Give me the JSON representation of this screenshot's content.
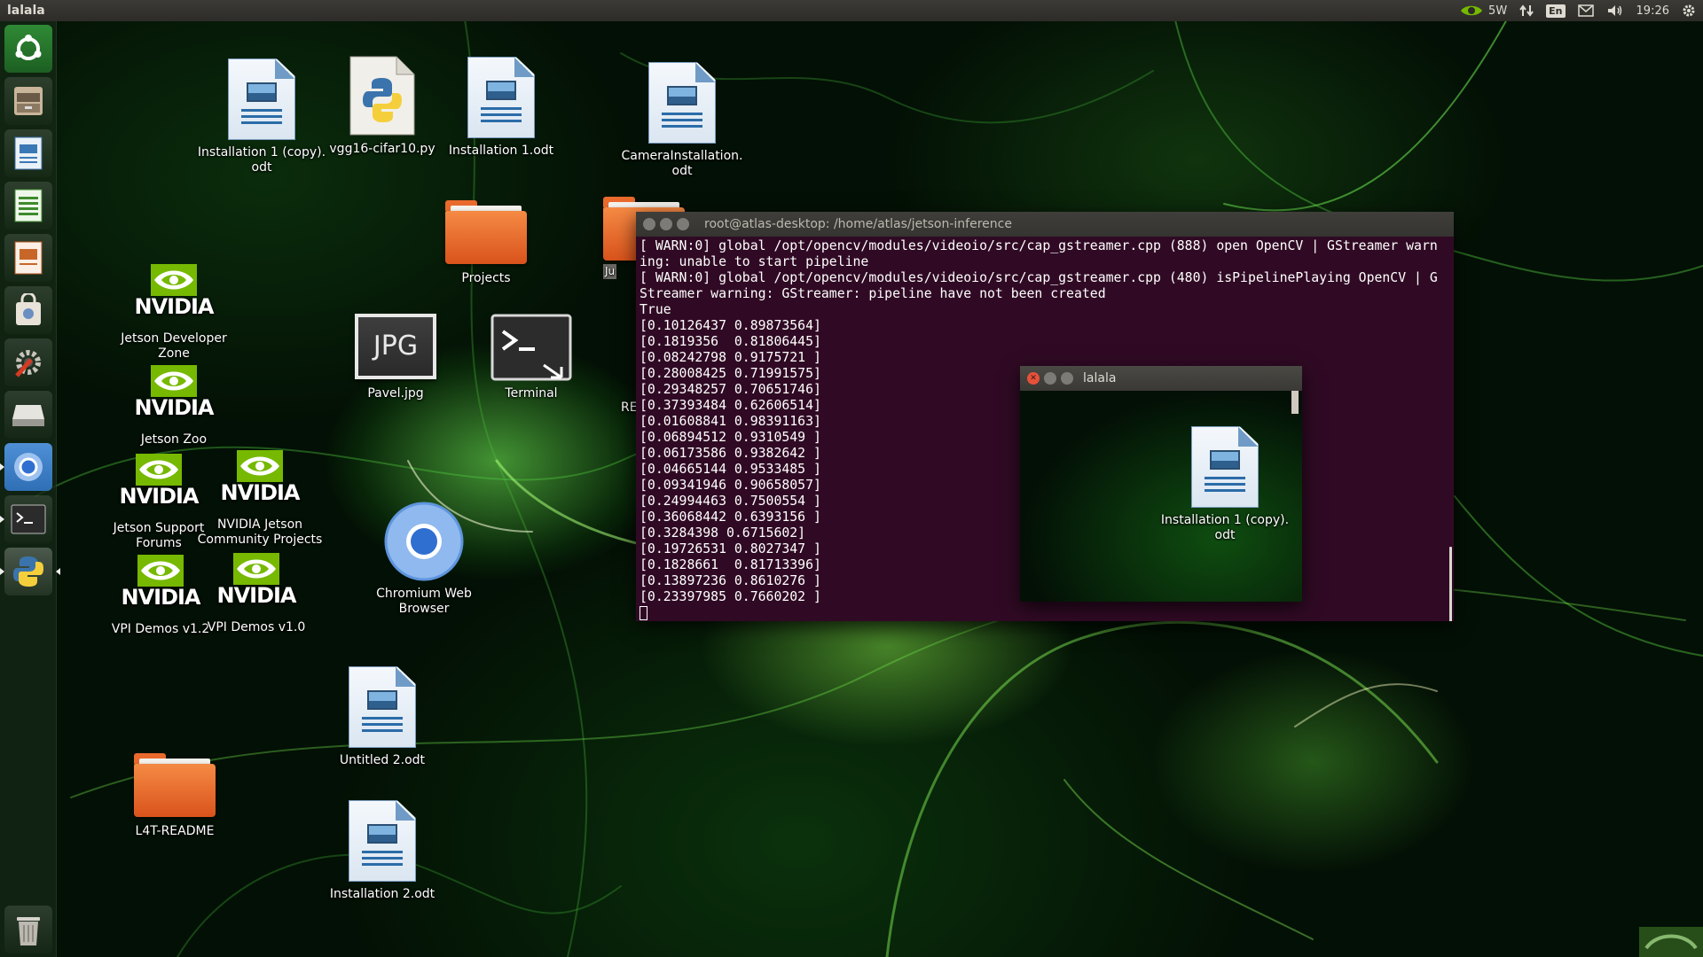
{
  "top_panel": {
    "title": "lalala",
    "tray": {
      "gpu_label": "5W",
      "keyboard_layout": "En",
      "clock": "19:26"
    }
  },
  "launcher": {
    "items": [
      {
        "name": "ubuntu-dash-icon"
      },
      {
        "name": "files-icon"
      },
      {
        "name": "writer-icon"
      },
      {
        "name": "calc-icon"
      },
      {
        "name": "impress-icon"
      },
      {
        "name": "software-center-icon"
      },
      {
        "name": "system-settings-icon"
      },
      {
        "name": "disk-icon"
      },
      {
        "name": "chromium-icon"
      },
      {
        "name": "terminal-icon"
      },
      {
        "name": "python-icon"
      },
      {
        "name": "trash-icon"
      }
    ]
  },
  "desktop": {
    "icons": {
      "installation_copy": "Installation 1 (copy).\nodt",
      "vgg16": "vgg16-cifar10.py",
      "installation1": "Installation 1.odt",
      "camera_installation": "CameraInstallation.\nodt",
      "projects": "Projects",
      "hidden_folder": "Ju",
      "pavel": "Pavel.jpg",
      "jpg_badge": "JPG",
      "terminal": "Terminal",
      "readme_partial": "RE",
      "jetson_dev_zone": "Jetson Developer\nZone",
      "jetson_zoo": "Jetson Zoo",
      "jetson_support": "Jetson Support\nForums",
      "nvidia_community": "NVIDIA Jetson\nCommunity Projects",
      "vpi_12": "VPI Demos v1.2",
      "vpi_10": "VPI Demos v1.0",
      "chromium": "Chromium Web\nBrowser",
      "untitled2": "Untitled 2.odt",
      "installation2": "Installation 2.odt",
      "l4t_readme": "L4T-README",
      "nvidia_word": "NVIDIA"
    }
  },
  "terminal_window": {
    "title": "root@atlas-desktop: /home/atlas/jetson-inference",
    "lines": [
      "[ WARN:0] global /opt/opencv/modules/videoio/src/cap_gstreamer.cpp (888) open OpenCV | GStreamer warn",
      "ing: unable to start pipeline",
      "[ WARN:0] global /opt/opencv/modules/videoio/src/cap_gstreamer.cpp (480) isPipelinePlaying OpenCV | G",
      "Streamer warning: GStreamer: pipeline have not been created",
      "True",
      "[0.10126437 0.89873564]",
      "[0.1819356  0.81806445]",
      "[0.08242798 0.9175721 ]",
      "[0.28008425 0.71991575]",
      "[0.29348257 0.70651746]",
      "[0.37393484 0.62606514]",
      "[0.01608841 0.98391163]",
      "[0.06894512 0.9310549 ]",
      "[0.06173586 0.9382642 ]",
      "[0.04665144 0.9533485 ]",
      "[0.09341946 0.90658057]",
      "[0.24994463 0.7500554 ]",
      "[0.36068442 0.6393156 ]",
      "[0.3284398 0.6715602]",
      "[0.19726531 0.8027347 ]",
      "[0.1828661  0.81713396]",
      "[0.13897236 0.8610276 ]",
      "[0.23397985 0.7660202 ]"
    ]
  },
  "preview_window": {
    "title": "lalala",
    "icon_label": "Installation 1 (copy).\nodt"
  },
  "colors": {
    "terminal_bg": "#300a24",
    "panel_bg": "#2d2c28",
    "close_button": "#e5513a",
    "nvidia_green": "#76b900",
    "folder_orange": "#e96a2c"
  }
}
